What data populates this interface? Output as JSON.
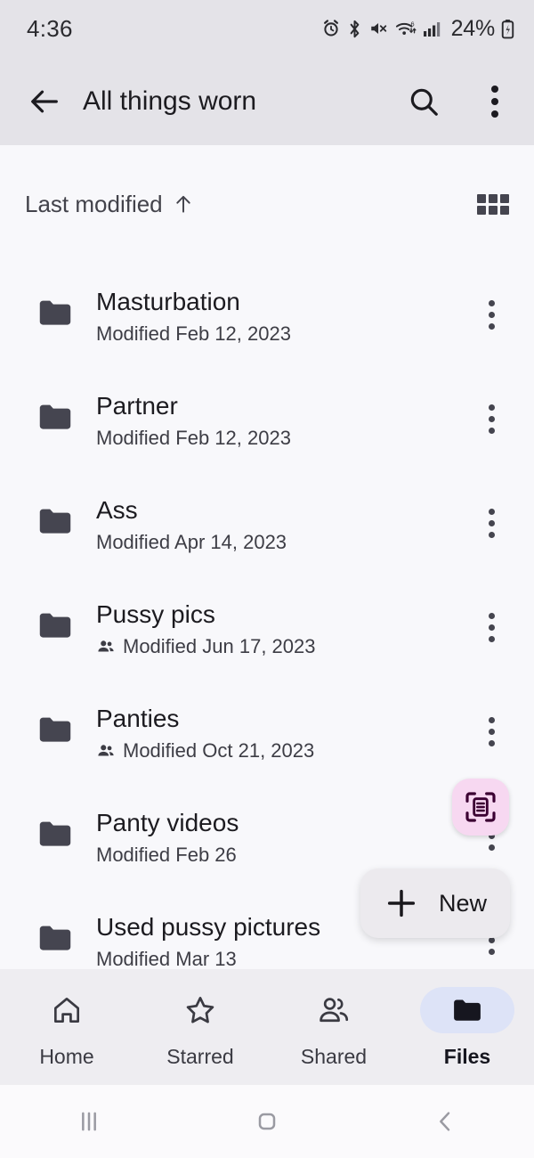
{
  "status_bar": {
    "time": "4:36",
    "battery_percent": "24%",
    "icons": [
      "alarm-icon",
      "bluetooth-icon",
      "volume-mute-icon",
      "wifi-6-icon",
      "cellular-signal-icon",
      "battery-charging-icon"
    ]
  },
  "app_bar": {
    "back_icon": "arrow-back-icon",
    "title": "All things worn",
    "search_icon": "search-icon",
    "overflow_icon": "more-vert-icon"
  },
  "sort_row": {
    "sort_label": "Last modified",
    "sort_direction_icon": "arrow-up-icon",
    "view_toggle_icon": "grid-view-icon"
  },
  "files": [
    {
      "name": "Masturbation",
      "modified": "Modified Feb 12, 2023",
      "shared": false,
      "icon": "folder-icon"
    },
    {
      "name": "Partner",
      "modified": "Modified Feb 12, 2023",
      "shared": false,
      "icon": "folder-icon"
    },
    {
      "name": "Ass",
      "modified": "Modified Apr 14, 2023",
      "shared": false,
      "icon": "folder-icon"
    },
    {
      "name": "Pussy pics",
      "modified": "Modified Jun 17, 2023",
      "shared": true,
      "icon": "folder-icon"
    },
    {
      "name": "Panties",
      "modified": "Modified Oct 21, 2023",
      "shared": true,
      "icon": "folder-icon"
    },
    {
      "name": "Panty videos",
      "modified": "Modified Feb 26",
      "shared": false,
      "icon": "folder-icon"
    },
    {
      "name": "Used pussy pictures",
      "modified": "Modified Mar 13",
      "shared": false,
      "icon": "folder-icon"
    }
  ],
  "fabs": {
    "scan_icon": "document-scan-icon",
    "new_plus_icon": "plus-icon",
    "new_label": "New"
  },
  "bottom_nav": {
    "items": [
      {
        "label": "Home",
        "icon": "home-icon",
        "active": false
      },
      {
        "label": "Starred",
        "icon": "star-icon",
        "active": false
      },
      {
        "label": "Shared",
        "icon": "people-icon",
        "active": false
      },
      {
        "label": "Files",
        "icon": "folder-icon",
        "active": true
      }
    ]
  },
  "android_nav": {
    "recents_icon": "recents-icon",
    "home_icon": "home-square-icon",
    "back_icon": "back-chevron-icon"
  },
  "colors": {
    "app_bar_bg": "#e4e3e8",
    "content_bg": "#f8f8fb",
    "bottom_nav_bg": "#eeedf1",
    "active_pill": "#dde3f7",
    "scan_fab_bg": "#f7d8f1",
    "new_fab_bg": "#eceaee",
    "folder": "#454550",
    "text_primary": "#1c1b20"
  }
}
